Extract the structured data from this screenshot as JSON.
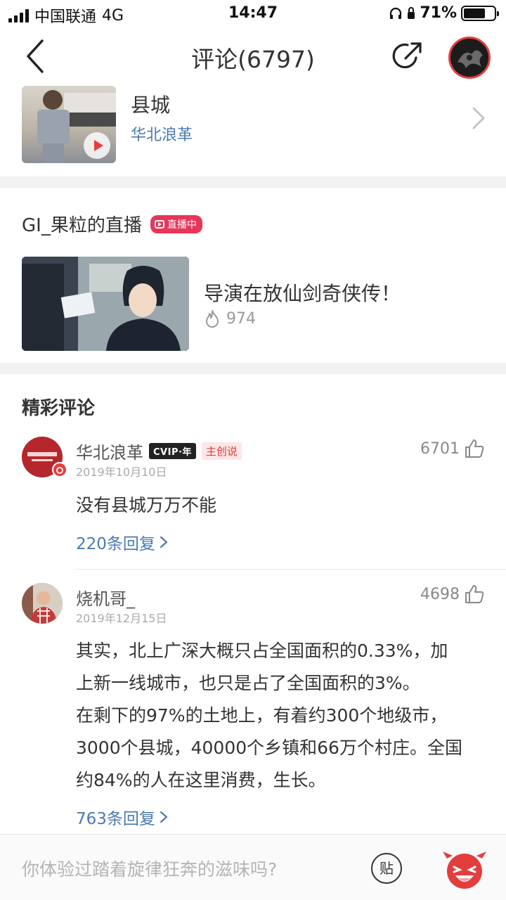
{
  "status_bar": {
    "carrier": "中国联通",
    "network": "4G",
    "time": "14:47",
    "battery": "71%",
    "battery_level": 0.71
  },
  "header": {
    "title": "评论(6797)"
  },
  "song": {
    "title": "县城",
    "artist": "华北浪革"
  },
  "live": {
    "name": "GI_果粒的直播",
    "badge": "直播中",
    "title": "导演在放仙剑奇侠传！",
    "views": "974"
  },
  "comments_section": {
    "title": "精彩评论",
    "items": [
      {
        "user": "华北浪革",
        "vip_badge": "CVIP·年",
        "creator_badge": "主创说",
        "date": "2019年10月10日",
        "likes": "6701",
        "text": "没有县城万万不能",
        "replies": "220条回复"
      },
      {
        "user": "烧机哥_",
        "date": "2019年12月15日",
        "likes": "4698",
        "text_lines": [
          "其实，北上广深大概只占全国面积的0.33%，加",
          "上新一线城市，也只是占了全国面积的3%。",
          "在剩下的97%的土地上，有着约300个地级市，",
          "3000个县城，40000个乡镇和66万个村庄。全国",
          "约84%的人在这里消费，生长。"
        ],
        "replies": "763条回复"
      }
    ]
  },
  "bottom_bar": {
    "placeholder": "你体验过踏着旋律狂奔的滋味吗?",
    "sticker_label": "贴"
  },
  "colors": {
    "accent_red": "#e33e3e",
    "link_blue": "#4a7ab0",
    "live_pink": "#e8365a"
  }
}
